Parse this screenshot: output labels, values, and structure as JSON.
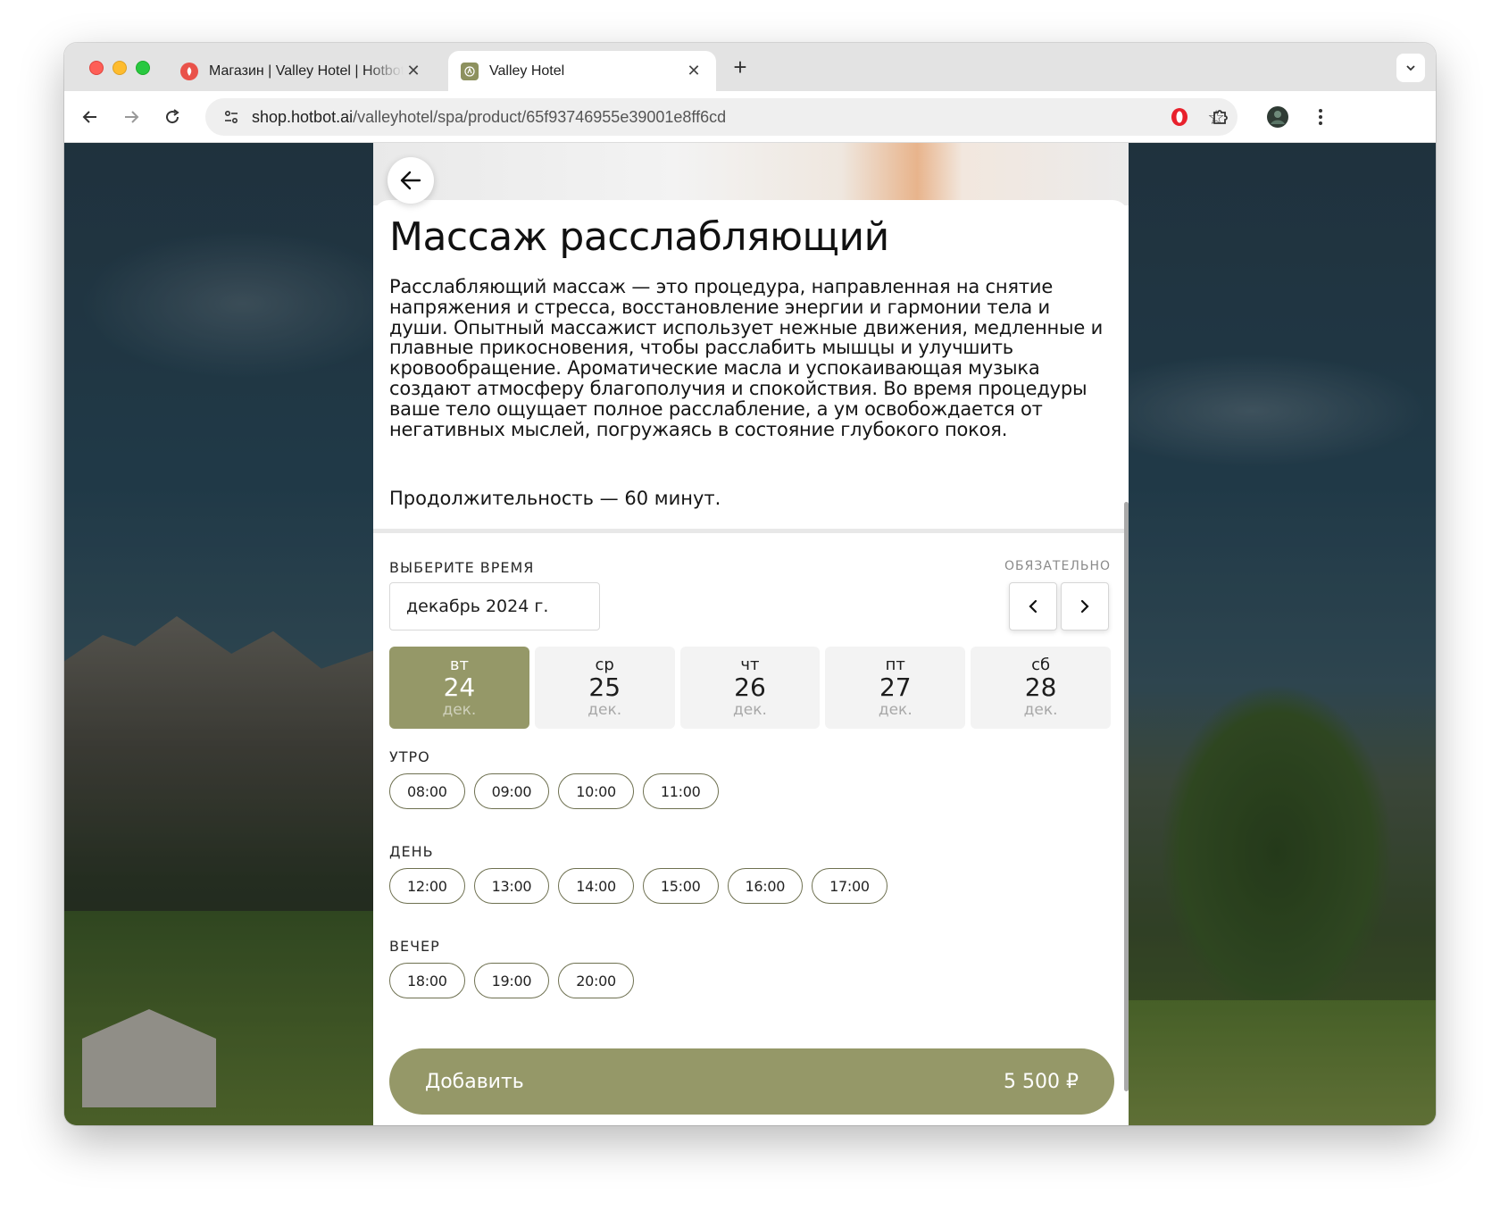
{
  "browser": {
    "tabs": [
      {
        "title": "Магазин | Valley Hotel | Hotbot",
        "active": false
      },
      {
        "title": "Valley Hotel",
        "active": true
      }
    ],
    "url_host": "shop.hotbot.ai",
    "url_path": "/valleyhotel/spa/product/65f93746955e39001e8ff6cd"
  },
  "product": {
    "title": "Массаж расслабляющий",
    "description": "Расслабляющий массаж — это процедура, направленная на снятие напряжения и стресса, восстановление энергии и гармонии тела и души. Опытный массажист использует нежные движения, медленные и плавные прикосновения, чтобы расслабить мышцы и улучшить кровообращение. Ароматические масла и успокаивающая музыка создают атмосферу благополучия и спокойствия. Во время процедуры ваше тело ощущает полное расслабление, а ум освобождается от негативных мыслей, погружаясь в состояние глубокого покоя.",
    "duration": "Продолжительность — 60 минут."
  },
  "booking": {
    "section_label": "ВЫБЕРИТЕ ВРЕМЯ",
    "required_label": "ОБЯЗАТЕЛЬНО",
    "month": "декабрь 2024 г.",
    "days": [
      {
        "dow": "вт",
        "num": "24",
        "mon": "дек.",
        "selected": true
      },
      {
        "dow": "ср",
        "num": "25",
        "mon": "дек.",
        "selected": false
      },
      {
        "dow": "чт",
        "num": "26",
        "mon": "дек.",
        "selected": false
      },
      {
        "dow": "пт",
        "num": "27",
        "mon": "дек.",
        "selected": false
      },
      {
        "dow": "сб",
        "num": "28",
        "mon": "дек.",
        "selected": false
      }
    ],
    "groups": [
      {
        "label": "УТРО",
        "slots": [
          "08:00",
          "09:00",
          "10:00",
          "11:00"
        ]
      },
      {
        "label": "ДЕНЬ",
        "slots": [
          "12:00",
          "13:00",
          "14:00",
          "15:00",
          "16:00",
          "17:00"
        ]
      },
      {
        "label": "ВЕЧЕР",
        "slots": [
          "18:00",
          "19:00",
          "20:00"
        ]
      }
    ]
  },
  "cta": {
    "label": "Добавить",
    "price": "5 500 ₽"
  },
  "colors": {
    "accent": "#959868",
    "slot_border": "#6e7050"
  },
  "icons": {
    "back": "arrow-left-icon",
    "prev": "chevron-left-icon",
    "next": "chevron-right-icon"
  }
}
